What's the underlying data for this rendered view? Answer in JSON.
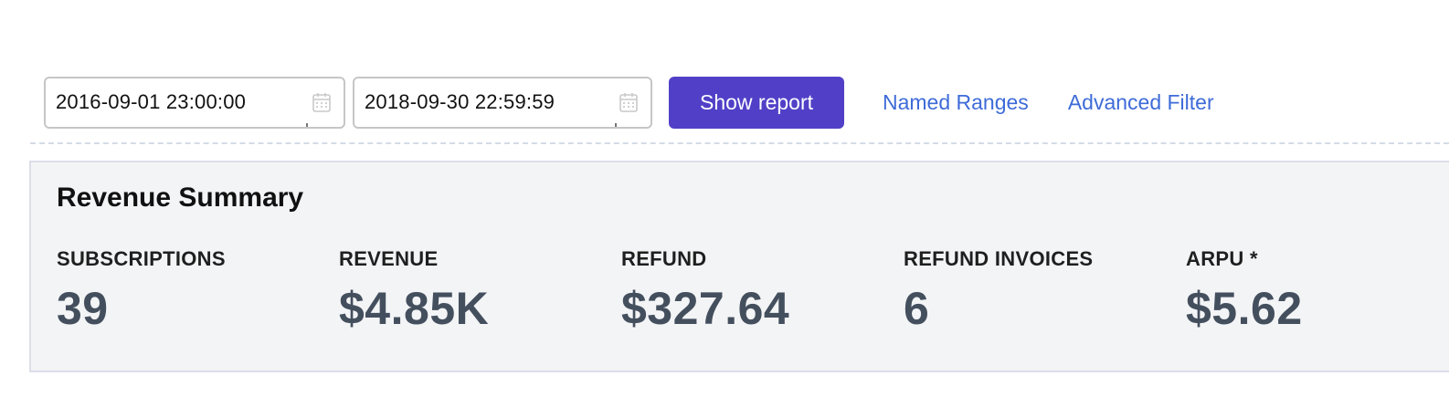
{
  "filters": {
    "start_date": "2016-09-01 23:00:00",
    "end_date": "2018-09-30 22:59:59",
    "show_report_label": "Show report",
    "named_ranges_label": "Named Ranges",
    "advanced_filter_label": "Advanced Filter",
    "calendar_icon": "calendar-icon"
  },
  "summary": {
    "title": "Revenue Summary",
    "metrics": [
      {
        "label": "SUBSCRIPTIONS",
        "value": "39"
      },
      {
        "label": "REVENUE",
        "value": "$4.85K"
      },
      {
        "label": "REFUND",
        "value": "$327.64"
      },
      {
        "label": "REFUND INVOICES",
        "value": "6"
      },
      {
        "label": "ARPU *",
        "value": "$5.62"
      }
    ]
  },
  "colors": {
    "primary_button": "#5140c7",
    "link": "#3e6bd8",
    "panel_background": "#f3f4f6",
    "metric_value": "#444f5e"
  }
}
